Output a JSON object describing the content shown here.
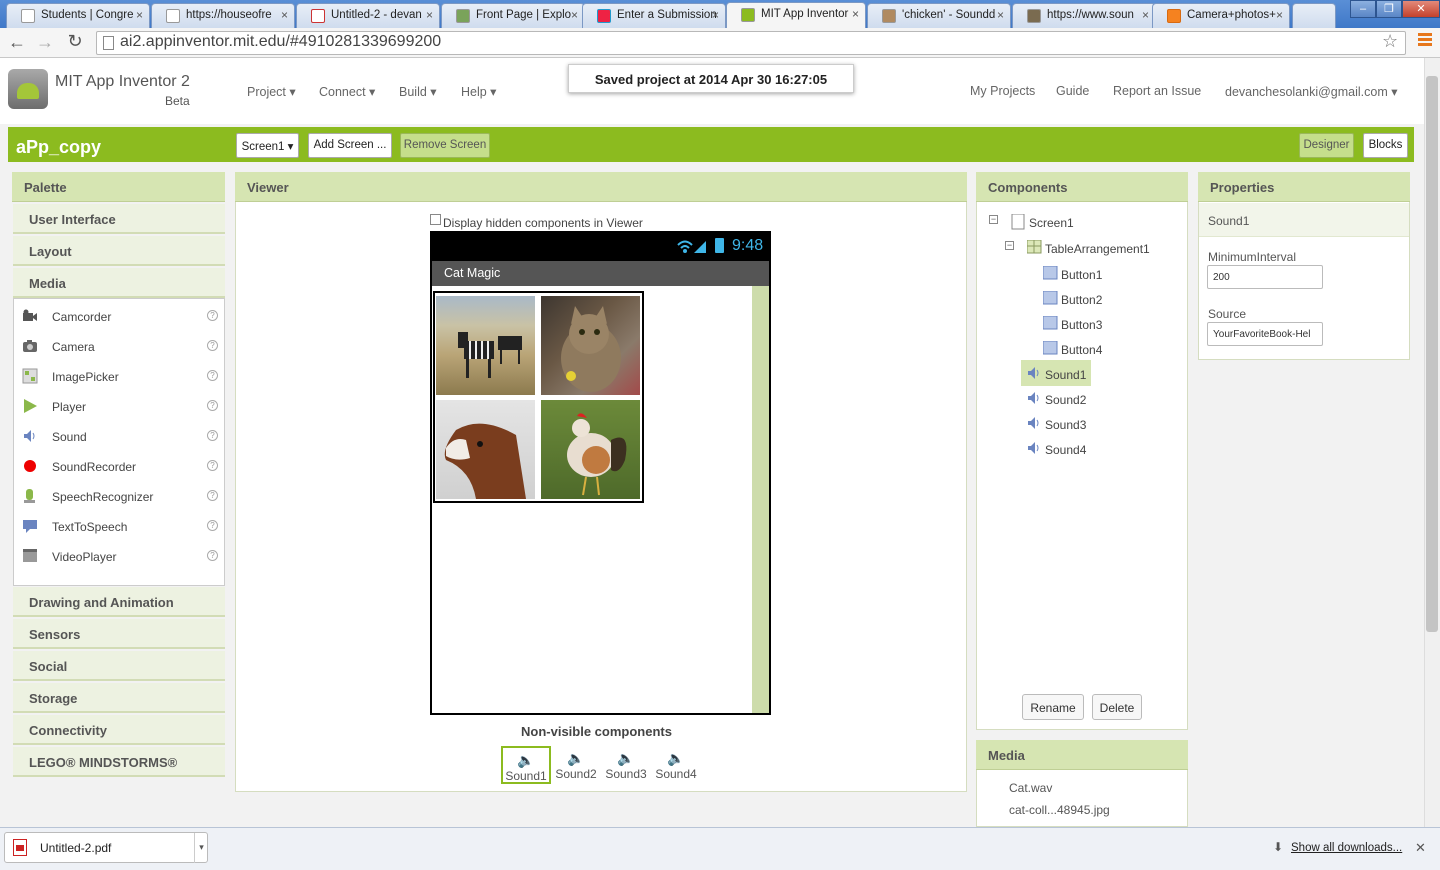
{
  "browser": {
    "tabs": [
      {
        "title": "Students | Congre"
      },
      {
        "title": "https://houseofre"
      },
      {
        "title": "Untitled-2 - devan"
      },
      {
        "title": "Front Page | Explo"
      },
      {
        "title": "Enter a Submission"
      },
      {
        "title": "MIT App Inventor"
      },
      {
        "title": "'chicken' - Soundd"
      },
      {
        "title": "https://www.soun"
      },
      {
        "title": "Camera+photos+"
      }
    ],
    "url": "ai2.appinventor.mit.edu/#4910281339699200",
    "window_controls": [
      "–",
      "❐",
      "✕"
    ]
  },
  "header": {
    "app_name": "MIT App Inventor 2",
    "beta": "Beta",
    "menus": [
      "Project ▾",
      "Connect ▾",
      "Build ▾",
      "Help ▾"
    ],
    "saved_notice": "Saved project at 2014 Apr 30 16:27:05",
    "right_links": [
      "My Projects",
      "Guide",
      "Report an Issue",
      "devanchesolanki@gmail.com ▾"
    ]
  },
  "project_bar": {
    "project_name": "aPp_copy",
    "screen_select": "Screen1 ▾",
    "add_screen": "Add Screen ...",
    "remove_screen": "Remove Screen",
    "designer": "Designer",
    "blocks": "Blocks"
  },
  "palette": {
    "title": "Palette",
    "categories_top": [
      "User Interface",
      "Layout",
      "Media"
    ],
    "media_items": [
      {
        "label": "Camcorder",
        "icon": "camcorder-icon"
      },
      {
        "label": "Camera",
        "icon": "camera-icon"
      },
      {
        "label": "ImagePicker",
        "icon": "imagepicker-icon"
      },
      {
        "label": "Player",
        "icon": "player-icon"
      },
      {
        "label": "Sound",
        "icon": "sound-icon"
      },
      {
        "label": "SoundRecorder",
        "icon": "soundrecorder-icon"
      },
      {
        "label": "SpeechRecognizer",
        "icon": "speechrecognizer-icon"
      },
      {
        "label": "TextToSpeech",
        "icon": "texttospeech-icon"
      },
      {
        "label": "VideoPlayer",
        "icon": "videoplayer-icon"
      }
    ],
    "categories_bottom": [
      "Drawing and Animation",
      "Sensors",
      "Social",
      "Storage",
      "Connectivity",
      "LEGO® MINDSTORMS®"
    ]
  },
  "viewer": {
    "title": "Viewer",
    "hidden_checkbox_label": "Display hidden components in Viewer",
    "phone_time": "9:48",
    "screen_title": "Cat Magic",
    "images": [
      "zebra",
      "cat",
      "horse",
      "rooster"
    ],
    "nonvisible_title": "Non-visible components",
    "nonvisible": [
      "Sound1",
      "Sound2",
      "Sound3",
      "Sound4"
    ]
  },
  "components": {
    "title": "Components",
    "screen": "Screen1",
    "arrangement": "TableArrangement1",
    "buttons": [
      "Button1",
      "Button2",
      "Button3",
      "Button4"
    ],
    "sounds": [
      "Sound1",
      "Sound2",
      "Sound3",
      "Sound4"
    ],
    "selected": "Sound1",
    "rename": "Rename",
    "delete": "Delete"
  },
  "media": {
    "title": "Media",
    "files": [
      "Cat.wav",
      "cat-coll...48945.jpg"
    ]
  },
  "properties": {
    "title": "Properties",
    "component": "Sound1",
    "min_interval_label": "MinimumInterval",
    "min_interval_value": "200",
    "source_label": "Source",
    "source_value": "YourFavoriteBook-Hel"
  },
  "downloads": {
    "file": "Untitled-2.pdf",
    "show_all": "Show all downloads..."
  },
  "colors": {
    "accent_green": "#8cbb1f",
    "panel_head": "#d6e5b2"
  }
}
